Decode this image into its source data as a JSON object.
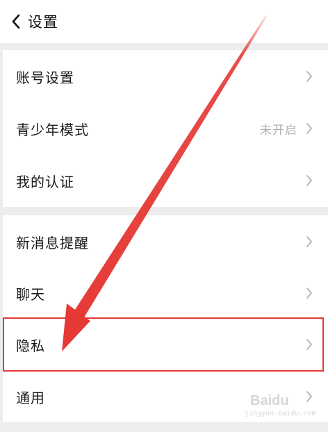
{
  "header": {
    "title": "设置",
    "back_icon": "chevron-left-icon"
  },
  "section1": {
    "items": [
      {
        "label": "账号设置",
        "value": ""
      },
      {
        "label": "青少年模式",
        "value": "未开启"
      },
      {
        "label": "我的认证",
        "value": ""
      }
    ]
  },
  "section2": {
    "items": [
      {
        "label": "新消息提醒",
        "value": ""
      },
      {
        "label": "聊天",
        "value": ""
      },
      {
        "label": "隐私",
        "value": ""
      },
      {
        "label": "通用",
        "value": ""
      }
    ]
  },
  "annotation": {
    "highlight_color": "#e53935",
    "highlighted_item": "隐私"
  },
  "watermark": {
    "logo": "Baidu",
    "sub": "jingyan.baidu.com"
  }
}
